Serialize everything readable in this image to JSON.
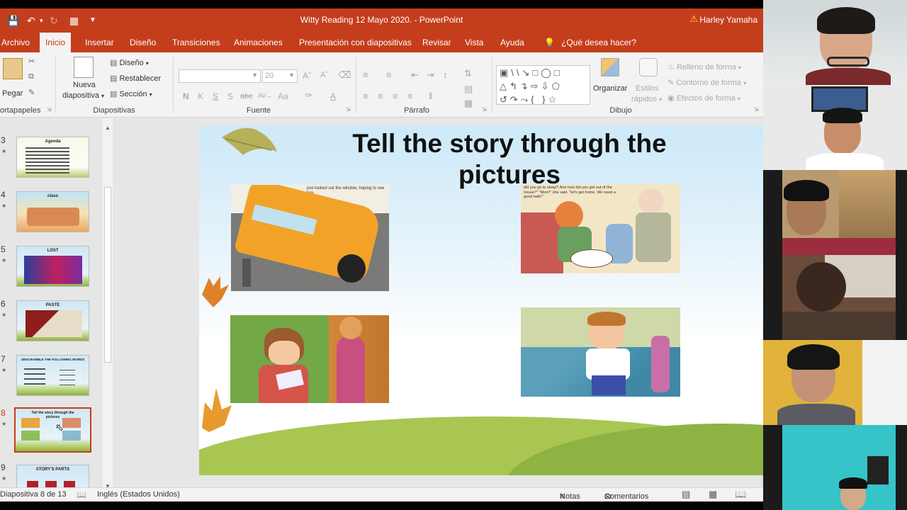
{
  "window": {
    "title": "Witty Reading 12 Mayo 2020.  -  PowerPoint",
    "user": "Harley Yamaha"
  },
  "menu": {
    "tabs": [
      "Archivo",
      "Inicio",
      "Insertar",
      "Diseño",
      "Transiciones",
      "Animaciones",
      "Presentación con diapositivas",
      "Revisar",
      "Vista",
      "Ayuda"
    ],
    "active": "Inicio",
    "tell_me": "¿Qué desea hacer?"
  },
  "ribbon": {
    "clipboard": {
      "paste": "Pegar",
      "label": "ortapapeles"
    },
    "slides": {
      "new_slide_line1": "Nueva",
      "new_slide_line2": "diapositiva",
      "layout": "Diseño",
      "reset": "Restablecer",
      "section": "Sección",
      "label": "Diapositivas"
    },
    "font": {
      "size": "20",
      "bold": "N",
      "italic": "K",
      "underline": "S",
      "shadow": "S",
      "strike": "abc",
      "case": "Aa",
      "label": "Fuente"
    },
    "paragraph": {
      "label": "Párrafo"
    },
    "drawing": {
      "arrange": "Organizar",
      "quick_styles_1": "Estilos",
      "quick_styles_2": "rápidos",
      "fill": "Relleno de forma",
      "outline": "Contorno de forma",
      "effects": "Efectos de forma",
      "label": "Dibujo"
    }
  },
  "thumbnails": [
    {
      "num": "3",
      "title": "Agenda"
    },
    {
      "num": "4",
      "title": "class"
    },
    {
      "num": "5",
      "title": "LOST"
    },
    {
      "num": "6",
      "title": "PASTE"
    },
    {
      "num": "7",
      "title": "UNSCRAMBLE THE FOLLOWING WORDS"
    },
    {
      "num": "8",
      "title": "Tell the story through the pictures",
      "selected": true
    },
    {
      "num": "9",
      "title": "STORY'S PARTS"
    }
  ],
  "slide": {
    "title": "Tell the story through the pictures",
    "panel1_caption": "just looked out the window, hoping to see him.",
    "panel2_caption": "did you go to sleep? And how did you get out of the house?\" \"Mom!\" she said. \"let's get home. We need a good bath!\""
  },
  "status": {
    "slide_count": "Diapositiva 8 de 13",
    "language": "Inglés (Estados Unidos)",
    "notes": "Notas",
    "comments": "Comentarios"
  },
  "colors": {
    "accent": "#c43e1c",
    "ribbon_bg": "#f3f3f3",
    "canvas_bg": "#e6e6e6",
    "slide_sky": "#cde9f8",
    "grass": "#a9c653"
  }
}
